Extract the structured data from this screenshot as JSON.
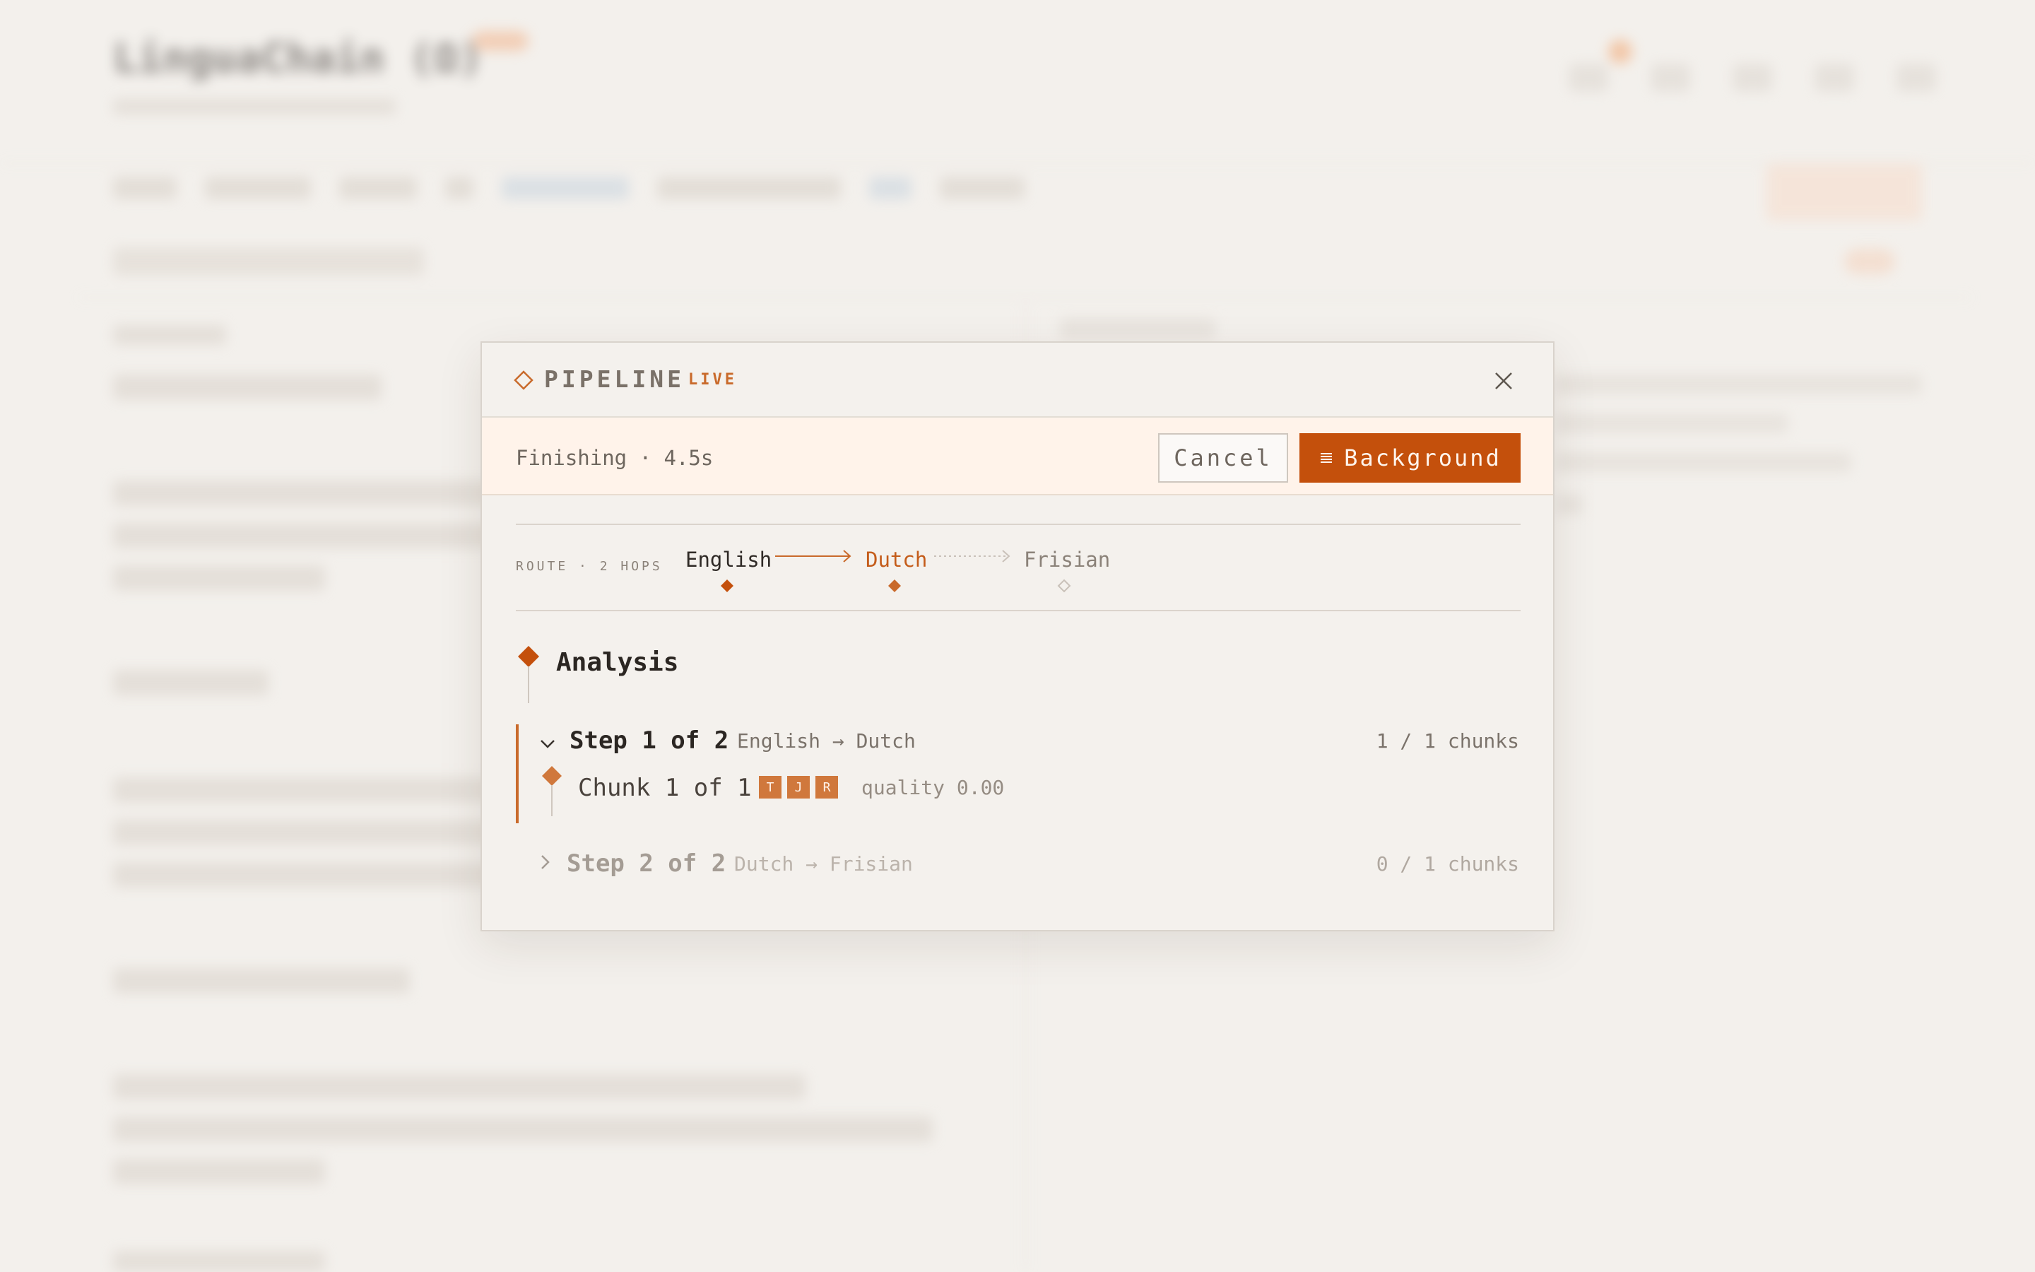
{
  "colors": {
    "accent": "#c4500c",
    "accent_soft": "#d0783c",
    "status_bg": "#fff3ea",
    "panel_bg": "#f4f1ed"
  },
  "modal": {
    "title": "PIPELINE",
    "live_badge": "LIVE",
    "status": "Finishing · 4.5s",
    "cancel_label": "Cancel",
    "background_label": "Background",
    "route": {
      "label": "ROUTE · 2 HOPS",
      "languages": [
        "English",
        "Dutch",
        "Frisian"
      ],
      "states": [
        "done",
        "active",
        "pending"
      ]
    },
    "analysis": {
      "title": "Analysis"
    },
    "steps": [
      {
        "title": "Step 1 of 2",
        "route": "English → Dutch",
        "count": "1 / 1 chunks",
        "expanded": true,
        "chunks": [
          {
            "title": "Chunk 1 of 1",
            "tags": [
              "T",
              "J",
              "R"
            ],
            "quality": "quality 0.00"
          }
        ]
      },
      {
        "title": "Step 2 of 2",
        "route": "Dutch → Frisian",
        "count": "0 / 1 chunks",
        "expanded": false
      }
    ]
  }
}
